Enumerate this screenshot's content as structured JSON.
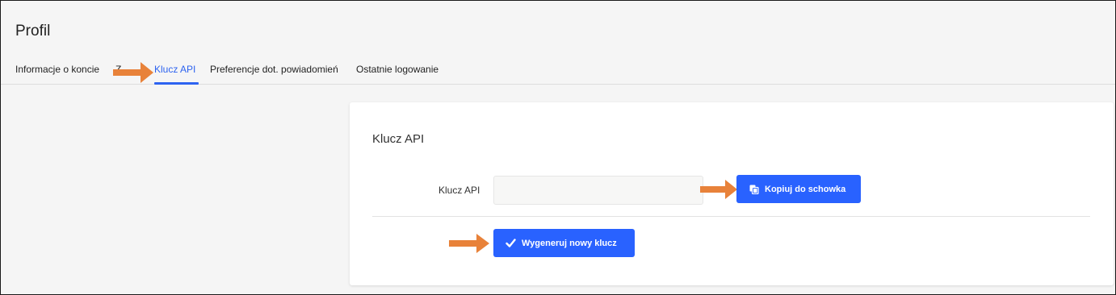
{
  "page": {
    "title": "Profil"
  },
  "tabs": [
    {
      "label": "Informacje o koncie"
    },
    {
      "label": "Z"
    },
    {
      "label": "Klucz API"
    },
    {
      "label": "Preferencje dot. powiadomień"
    },
    {
      "label": "Ostatnie logowanie"
    }
  ],
  "active_tab": "Klucz API",
  "card": {
    "title": "Klucz API",
    "field_label": "Klucz API",
    "api_key_value": "",
    "copy_button": "Kopiuj do schowka",
    "generate_button": "Wygeneruj nowy klucz"
  },
  "icons": {
    "copy": "copy-icon",
    "check": "check-icon",
    "annotation": "arrow-right-icon"
  },
  "colors": {
    "accent": "#2962ff",
    "active_tab": "#2d63f0",
    "annotation_arrow": "#e8823a",
    "background": "#f5f5f5",
    "card": "#ffffff"
  }
}
